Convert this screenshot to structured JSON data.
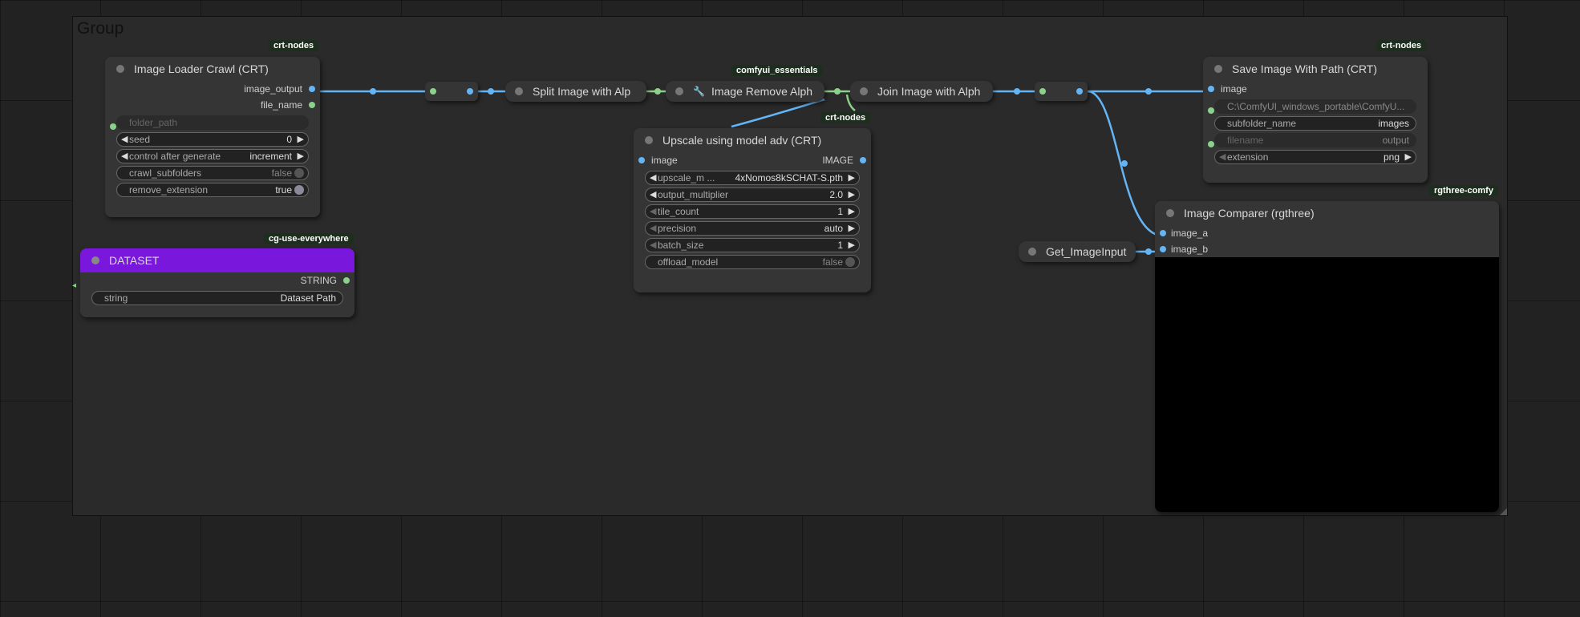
{
  "group": {
    "title": "Group"
  },
  "nodes": {
    "loader": {
      "badge": "crt-nodes",
      "title": "Image Loader Crawl (CRT)",
      "outputs": [
        "image_output",
        "file_name"
      ],
      "folder_path": {
        "placeholder": "folder_path"
      },
      "seed": {
        "label": "seed",
        "value": "0"
      },
      "control": {
        "label": "control after generate",
        "value": "increment"
      },
      "crawl_subfolders": {
        "label": "crawl_subfolders",
        "value": "false"
      },
      "remove_extension": {
        "label": "remove_extension",
        "value": "true"
      }
    },
    "dataset": {
      "badge": "cg-use-everywhere",
      "title": "DATASET",
      "output": "STRING",
      "string": {
        "label": "string",
        "value": "Dataset Path"
      },
      "header_color": "#7a17dd"
    },
    "split": {
      "title": "Split Image with Alp"
    },
    "remove_alpha": {
      "badge": "comfyui_essentials",
      "title": "Image Remove Alph",
      "icon": "wrench-icon"
    },
    "join": {
      "title": "Join Image with Alph"
    },
    "upscale": {
      "badge": "crt-nodes",
      "title": "Upscale using model adv (CRT)",
      "input": "image",
      "output": "IMAGE",
      "upscale_model": {
        "label": "upscale_m ...",
        "value": "4xNomos8kSCHAT-S.pth"
      },
      "output_multiplier": {
        "label": "output_multiplier",
        "value": "2.0"
      },
      "tile_count": {
        "label": "tile_count",
        "value": "1"
      },
      "precision": {
        "label": "precision",
        "value": "auto"
      },
      "batch_size": {
        "label": "batch_size",
        "value": "1"
      },
      "offload_model": {
        "label": "offload_model",
        "value": "false"
      }
    },
    "save": {
      "badge": "crt-nodes",
      "title": "Save Image With Path (CRT)",
      "input": "image",
      "path": {
        "value": "C:\\ComfyUI_windows_portable\\ComfyU..."
      },
      "subfolder_name": {
        "label": "subfolder_name",
        "value": "images"
      },
      "filename": {
        "label": "filename",
        "value": "output"
      },
      "extension": {
        "label": "extension",
        "value": "png"
      }
    },
    "comparer": {
      "badge": "rgthree-comfy",
      "title": "Image Comparer (rgthree)",
      "inputs": [
        "image_a",
        "image_b"
      ]
    },
    "get_image": {
      "title": "Get_ImageInput"
    }
  },
  "colors": {
    "image_wire": "#64b5f6",
    "string_wire": "#8bd18b",
    "canvas": "#222222",
    "node": "#353535"
  }
}
